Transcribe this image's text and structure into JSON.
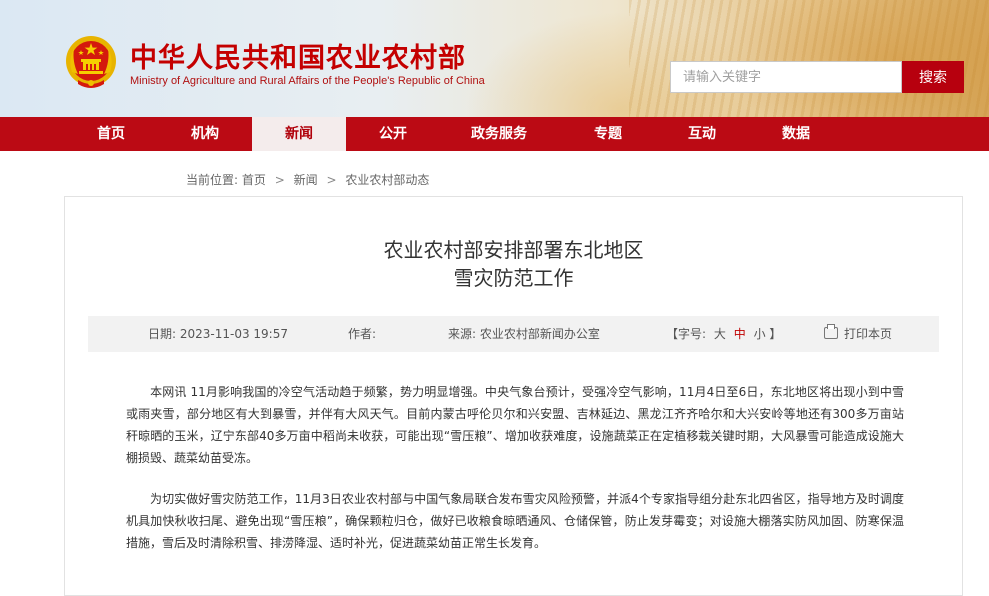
{
  "header": {
    "title_cn": "中华人民共和国农业农村部",
    "title_en": "Ministry of Agriculture and Rural Affairs of the People's Republic of China",
    "search_placeholder": "请输入关键字",
    "search_button": "搜索",
    "emblem_icon": "national-emblem-icon"
  },
  "nav": {
    "items": [
      {
        "label": "首页"
      },
      {
        "label": "机构"
      },
      {
        "label": "新闻",
        "active": true
      },
      {
        "label": "公开"
      },
      {
        "label": "政务服务"
      },
      {
        "label": "专题"
      },
      {
        "label": "互动"
      },
      {
        "label": "数据"
      }
    ]
  },
  "breadcrumb": {
    "prefix": "当前位置:",
    "items": [
      "首页",
      "新闻",
      "农业农村部动态"
    ],
    "separator": ">"
  },
  "article": {
    "title_line1": "农业农村部安排部署东北地区",
    "title_line2": "雪灾防范工作",
    "meta": {
      "date": "日期: 2023-11-03 19:57",
      "author": "作者:",
      "source": "来源: 农业农村部新闻办公室",
      "fontsize_label": "【字号:",
      "fontsize_large": "大",
      "fontsize_medium": "中",
      "fontsize_small": "小",
      "fontsize_close": "】",
      "print": "打印本页",
      "print_icon": "printer-icon"
    },
    "paragraphs": [
      "本网讯 11月影响我国的冷空气活动趋于频繁，势力明显增强。中央气象台预计，受强冷空气影响，11月4日至6日，东北地区将出现小到中雪或雨夹雪，部分地区有大到暴雪，并伴有大风天气。目前内蒙古呼伦贝尔和兴安盟、吉林延边、黑龙江齐齐哈尔和大兴安岭等地还有300多万亩站秆晾晒的玉米，辽宁东部40多万亩中稻尚未收获，可能出现“雪压粮”、增加收获难度，设施蔬菜正在定植移栽关键时期，大风暴雪可能造成设施大棚损毁、蔬菜幼苗受冻。",
      "为切实做好雪灾防范工作，11月3日农业农村部与中国气象局联合发布雪灾风险预警，并派4个专家指导组分赴东北四省区，指导地方及时调度机具加快秋收扫尾、避免出现“雪压粮”，确保颗粒归仓，做好已收粮食晾晒通风、仓储保管，防止发芽霉变；对设施大棚落实防风加固、防寒保温措施，雪后及时清除积雪、排涝降湿、适时补光，促进蔬菜幼苗正常生长发育。"
    ]
  },
  "colors": {
    "brand_red": "#bb0a14",
    "active_tab_bg": "#f4ecec",
    "search_button": "#b7000e"
  }
}
